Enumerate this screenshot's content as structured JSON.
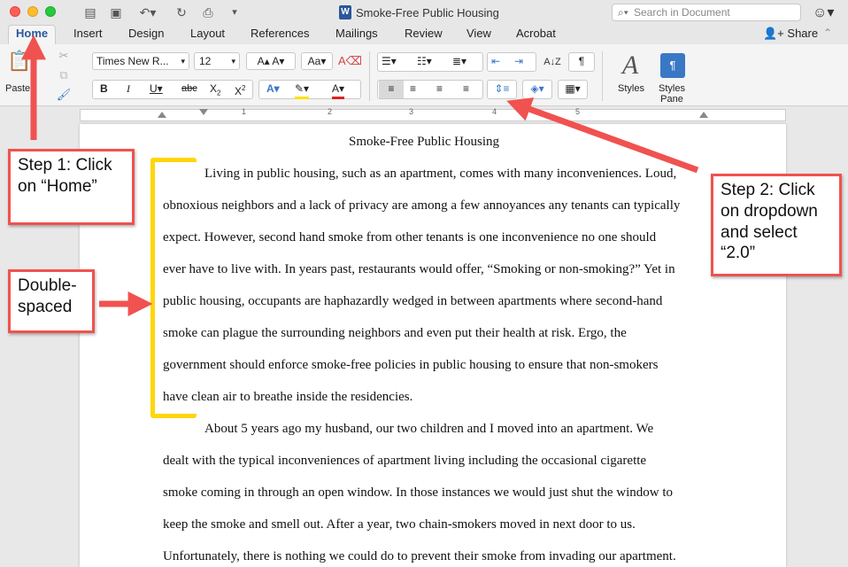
{
  "window": {
    "title": "Smoke-Free Public Housing",
    "search_placeholder": "Search in Document"
  },
  "tabs": [
    "Home",
    "Insert",
    "Design",
    "Layout",
    "References",
    "Mailings",
    "Review",
    "View",
    "Acrobat"
  ],
  "share_label": "Share",
  "ribbon": {
    "paste_label": "Paste",
    "font_name": "Times New R...",
    "font_size": "12",
    "styles_label": "Styles",
    "styles_pane_label_1": "Styles",
    "styles_pane_label_2": "Pane"
  },
  "ruler_numbers": [
    "1",
    "2",
    "3",
    "4",
    "5"
  ],
  "document": {
    "heading": "Smoke-Free Public Housing",
    "lines": [
      "Living in public housing, such as an apartment, comes with many inconveniences. Loud,",
      "obnoxious neighbors and a lack of privacy are among a few annoyances any tenants can typically",
      "expect. However, second hand smoke from other tenants is one inconvenience no one should",
      "ever have to live with. In years past, restaurants would offer, “Smoking or non-smoking?” Yet in",
      "public housing, occupants are haphazardly wedged in between apartments where second-hand",
      "smoke can plague the surrounding neighbors and even put their health at risk. Ergo, the",
      "government should enforce smoke-free policies in public housing to ensure that non-smokers",
      "have clean air to breathe inside the residencies.",
      "About 5 years ago my husband, our two children and I moved into an apartment. We",
      "dealt with the typical inconveniences of apartment living including the occasional cigarette",
      "smoke coming in through an open window. In those instances we would just shut the window to",
      "keep the smoke and smell out. After a year, two chain-smokers moved in next door to us.",
      "Unfortunately, there is nothing we could do to prevent their smoke from invading our apartment."
    ]
  },
  "annotations": {
    "step1": "Step 1: Click on “Home”",
    "step2": "Step 2: Click on dropdown and select “2.0”",
    "double_spaced": "Double-spaced"
  },
  "colors": {
    "callout_border": "#f0524f",
    "arrow": "#f0524f",
    "bracket": "#ffd60a",
    "accent": "#2b579a"
  }
}
